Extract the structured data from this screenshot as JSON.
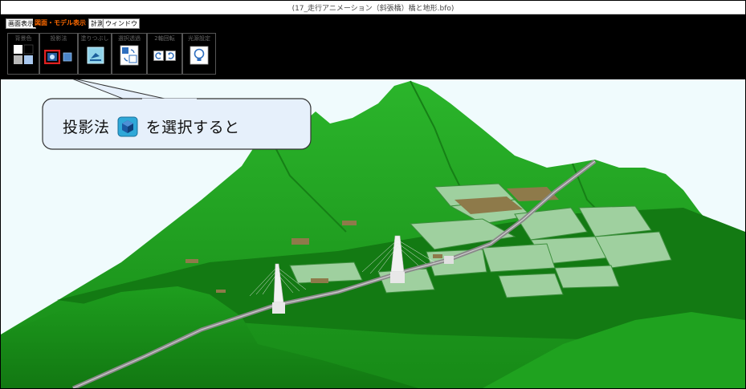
{
  "window": {
    "title": "(17_走行アニメーション（斜張橋）橋と地形.bfo)"
  },
  "menu_tabs": [
    "画面表示",
    "図面・モデル表示",
    "計測",
    "ウィンドウ"
  ],
  "toolbar_groups": [
    "背景色",
    "投影法",
    "塗りつぶし",
    "選択透過",
    "2軸回転",
    "光源設定"
  ],
  "callout": {
    "text_before": "投影法",
    "text_after": "を選択すると"
  },
  "icons": {
    "background": "background-color-swatch-icon",
    "projection_perspective": "perspective-cube-icon",
    "projection_parallel": "parallel-cube-icon",
    "fill": "fill-paint-icon",
    "transparency": "selection-transparency-icon",
    "rotate_left": "rotate-left-icon",
    "rotate_right": "rotate-right-icon",
    "light": "light-bulb-icon",
    "callout_projection": "projection-cube-icon"
  },
  "colors": {
    "highlight": "#e02020",
    "active_tab": "#ff6a00",
    "terrain": "#1f9a1f",
    "sky": "#f0fbfd"
  }
}
